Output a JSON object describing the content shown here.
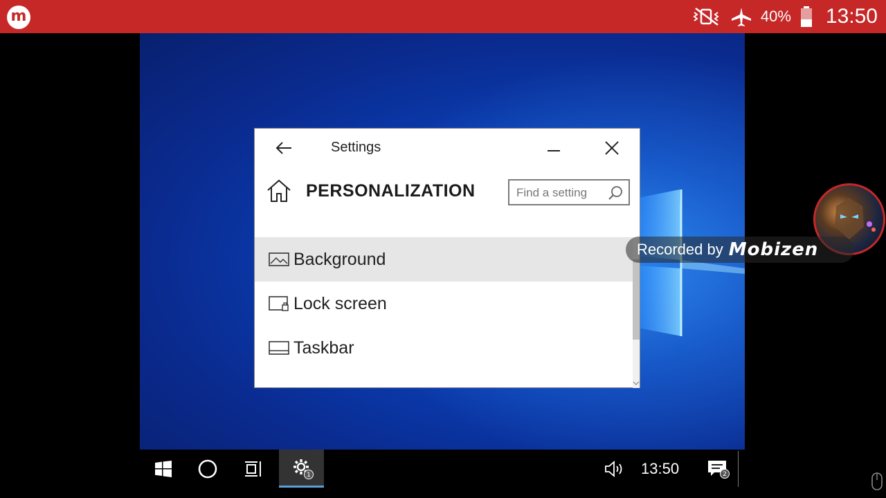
{
  "statusbar": {
    "app_icon": "mobizen-logo",
    "app_logo_letter": "m",
    "icons": [
      "vibrate-off-icon",
      "airplane-icon",
      "battery-icon"
    ],
    "battery_percent": "40%",
    "time": "13:50",
    "background_color": "#c62828"
  },
  "window": {
    "title": "Settings",
    "back_icon": "back-arrow-icon",
    "minimize_icon": "minimize-icon",
    "close_icon": "close-icon"
  },
  "page": {
    "title": "PERSONALIZATION",
    "home_icon": "home-icon"
  },
  "search": {
    "placeholder": "Find a setting",
    "icon": "search-icon"
  },
  "menu": {
    "items": [
      {
        "label": "Background",
        "icon": "picture-icon",
        "selected": true
      },
      {
        "label": "Lock screen",
        "icon": "lock-screen-icon",
        "selected": false
      },
      {
        "label": "Taskbar",
        "icon": "taskbar-icon",
        "selected": false
      }
    ]
  },
  "overlay": {
    "recorded_by": "Recorded by",
    "brand": "Mobizen"
  },
  "taskbar": {
    "start_icon": "windows-start-icon",
    "search_icon": "cortana-circle-icon",
    "task_view_icon": "task-view-icon",
    "settings_icon": "settings-gear-icon",
    "settings_badge": "1",
    "volume_icon": "volume-icon",
    "clock": "13:50",
    "notification_icon": "action-center-icon",
    "notification_badge": "2",
    "accent_color": "#5a9fd6"
  }
}
